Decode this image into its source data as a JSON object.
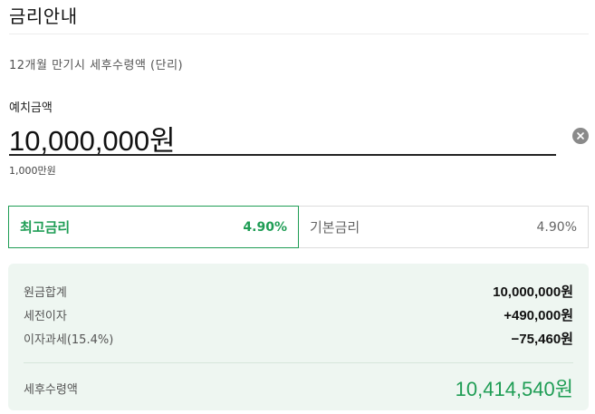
{
  "header": {
    "title": "금리안내"
  },
  "subtitle": "12개월 만기시 세후수령액 (단리)",
  "deposit": {
    "label": "예치금액",
    "value": "10,000,000원",
    "hint": "1,000만원"
  },
  "rates": {
    "max": {
      "label": "최고금리",
      "value": "4.90%"
    },
    "base": {
      "label": "기본금리",
      "value": "4.90%"
    }
  },
  "summary": {
    "principal": {
      "label": "원금합계",
      "value": "10,000,000원"
    },
    "pretax_interest": {
      "label": "세전이자",
      "value": "+490,000원"
    },
    "interest_tax": {
      "label": "이자과세(15.4%)",
      "value": "−75,460원"
    },
    "after_tax": {
      "label": "세후수령액",
      "value": "10,414,540원"
    }
  },
  "colors": {
    "accent": "#1f9d55",
    "summary_bg": "#eef6f1"
  },
  "icons": {
    "clear": "close-circle-icon"
  }
}
